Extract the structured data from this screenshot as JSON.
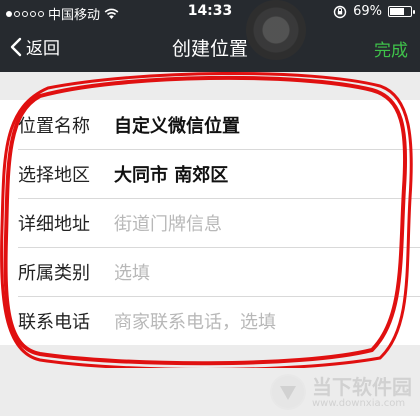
{
  "status_bar": {
    "carrier": "中国移动",
    "time": "14:33",
    "battery_percent": "69%",
    "battery_level": 0.69,
    "signal_filled": 1,
    "signal_total": 5
  },
  "nav": {
    "back_label": "返回",
    "title": "创建位置",
    "done_label": "完成"
  },
  "form": {
    "rows": [
      {
        "label": "位置名称",
        "value": "自定义微信位置",
        "placeholder": ""
      },
      {
        "label": "选择地区",
        "value": "大同市 南郊区",
        "placeholder": ""
      },
      {
        "label": "详细地址",
        "value": "",
        "placeholder": "街道门牌信息"
      },
      {
        "label": "所属类别",
        "value": "",
        "placeholder": "选填"
      },
      {
        "label": "联系电话",
        "value": "",
        "placeholder": "商家联系电话，选填"
      }
    ]
  },
  "watermark": {
    "brand": "当下软件园",
    "url": "www.downxia.com"
  },
  "colors": {
    "nav_bg": "#262a2f",
    "done": "#3fc24a",
    "annotation": "#e01010",
    "placeholder": "#b8b8b8"
  }
}
